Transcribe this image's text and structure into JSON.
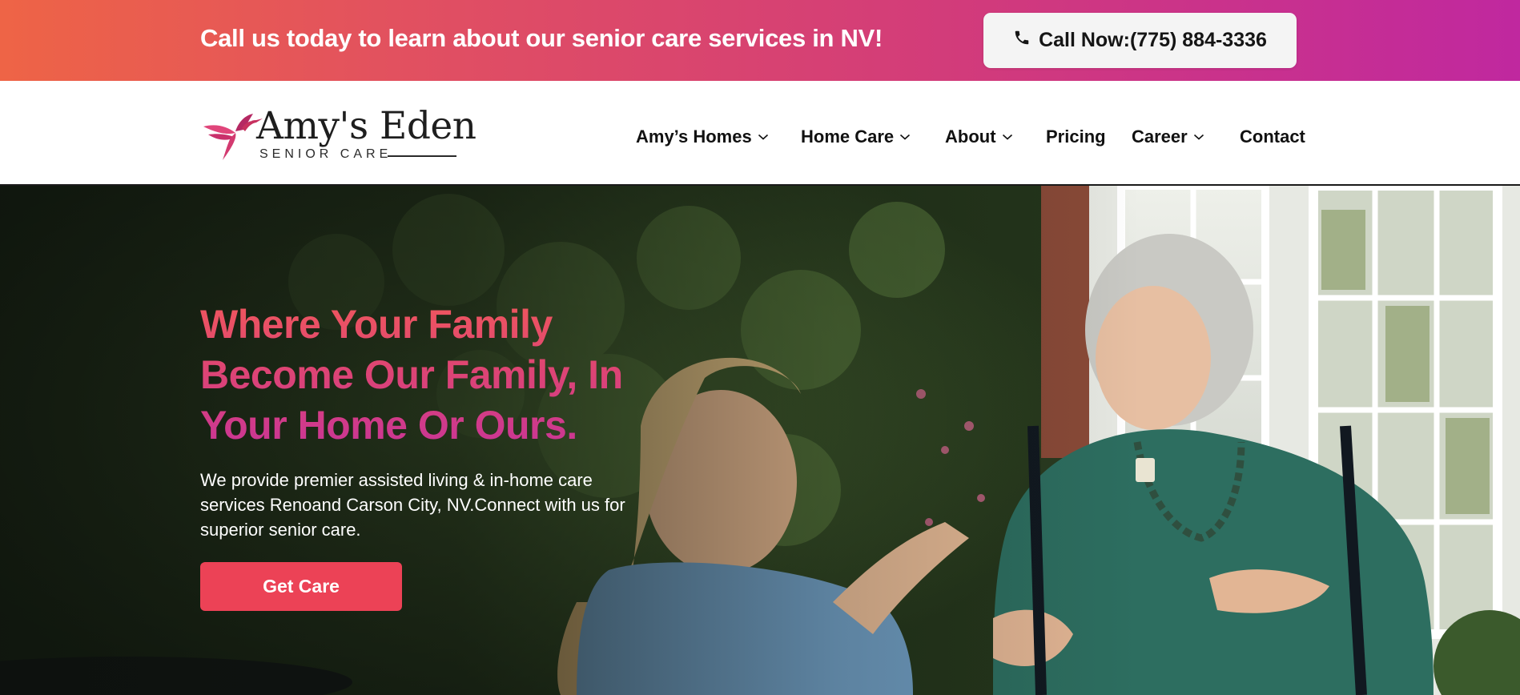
{
  "topbar": {
    "message": "Call us today to learn about our senior care services in NV!",
    "call_button_label": "Call Now:(775) 884-3336",
    "call_icon": "phone-icon"
  },
  "logo": {
    "name": "Amy's Eden",
    "tagline": "SENIOR CARE",
    "icon": "hummingbird-icon"
  },
  "nav": {
    "items": [
      {
        "label": "Amy’s Homes",
        "has_dropdown": true
      },
      {
        "label": "Home Care",
        "has_dropdown": true
      },
      {
        "label": "About",
        "has_dropdown": true
      },
      {
        "label": "Pricing",
        "has_dropdown": false
      },
      {
        "label": "Career",
        "has_dropdown": true
      },
      {
        "label": "Contact",
        "has_dropdown": false
      }
    ]
  },
  "hero": {
    "title_line1": "Where Your Family",
    "title_line2": "Become Our Family, In",
    "title_line3": "Your Home Or Ours.",
    "subtitle_line1": "We provide premier assisted living & in-home care",
    "subtitle_line2": "services Renoand Carson City, NV.Connect with us for",
    "subtitle_line3": "superior senior care.",
    "cta_label": "Get Care"
  },
  "colors": {
    "topbar_gradient_start": "#ee6446",
    "topbar_gradient_end": "#c0289f",
    "cta_red": "#ec4256",
    "title_gradient_start": "#f0575d",
    "title_gradient_end": "#c93596",
    "logo_accent": "#d6336c"
  }
}
